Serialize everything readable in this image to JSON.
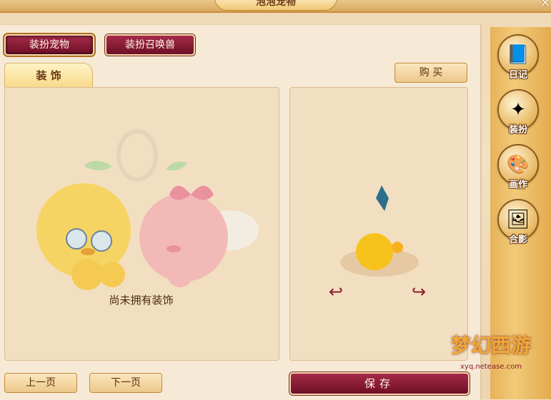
{
  "window": {
    "title": "泡泡宠物",
    "close_symbol": "✕"
  },
  "tabs_top": [
    {
      "label": "装扮宠物",
      "active": true
    },
    {
      "label": "装扮召唤兽",
      "active": false
    }
  ],
  "decoration_tab": {
    "label": "装 饰"
  },
  "buy_button": {
    "label": "购 买"
  },
  "left_panel": {
    "empty_text": "尚未拥有装饰"
  },
  "pagination": {
    "prev_label": "上一页",
    "next_label": "下一页"
  },
  "save_button": {
    "label": "保存"
  },
  "sidebar": {
    "items": [
      {
        "label": "日记",
        "icon": "diary-icon"
      },
      {
        "label": "装扮",
        "icon": "pinwheel-icon"
      },
      {
        "label": "画作",
        "icon": "painting-icon"
      },
      {
        "label": "合影",
        "icon": "photo-icon"
      }
    ]
  },
  "watermark": {
    "text": "梦幻西游",
    "url": "xyq.netease.com"
  },
  "colors": {
    "primary_button": "#8a1b36",
    "panel_bg": "#f2dfc1",
    "sidebar_gold": "#eec070"
  }
}
